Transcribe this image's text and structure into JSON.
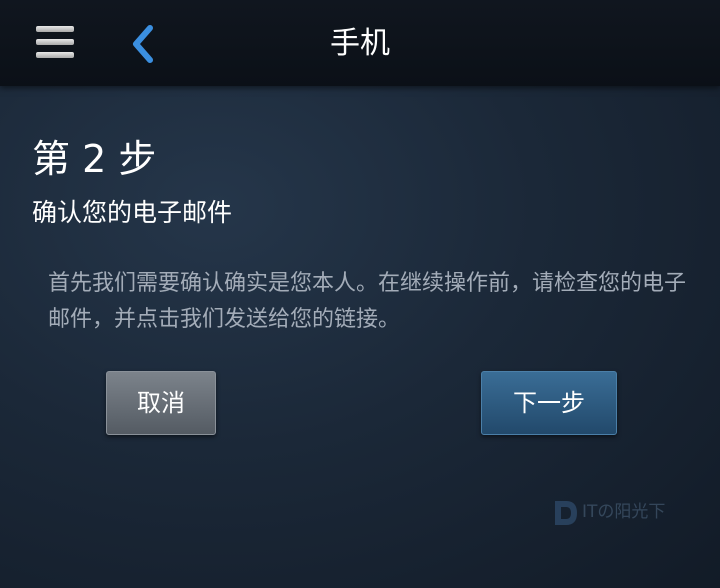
{
  "header": {
    "title": "手机",
    "menu_icon": "hamburger-menu-icon",
    "back_icon": "chevron-left-icon"
  },
  "step": {
    "title": "第 2 步",
    "subtitle": "确认您的电子邮件"
  },
  "description": "首先我们需要确认确实是您本人。在继续操作前，请检查您的电子邮件，并点击我们发送给您的链接。",
  "buttons": {
    "cancel_label": "取消",
    "next_label": "下一步"
  },
  "watermark": {
    "text": "ITの阳光下"
  },
  "colors": {
    "back_arrow": "#3b8fe0",
    "background": "#1b2838",
    "next_button": "#2d5c80",
    "cancel_button": "#676e76"
  }
}
